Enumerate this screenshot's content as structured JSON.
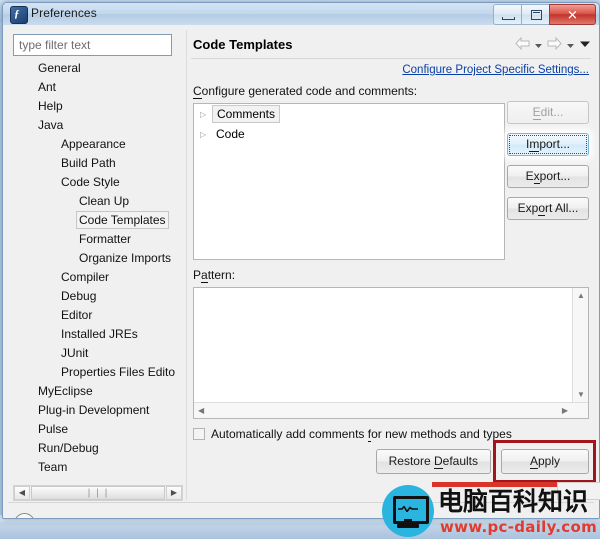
{
  "window": {
    "title": "Preferences",
    "icon": "eclipse-icon",
    "icon_glyph": "ƒ",
    "controls": {
      "minimize": "minimize-button",
      "maximize": "maximize-button",
      "close_label": "✕"
    }
  },
  "sidebar": {
    "filter": {
      "placeholder": "type filter text",
      "value": ""
    },
    "items": [
      {
        "label": "General",
        "level": 0,
        "selected": false
      },
      {
        "label": "Ant",
        "level": 0,
        "selected": false
      },
      {
        "label": "Help",
        "level": 0,
        "selected": false
      },
      {
        "label": "Java",
        "level": 0,
        "selected": false
      },
      {
        "label": "Appearance",
        "level": 1,
        "selected": false
      },
      {
        "label": "Build Path",
        "level": 1,
        "selected": false
      },
      {
        "label": "Code Style",
        "level": 1,
        "selected": false
      },
      {
        "label": "Clean Up",
        "level": 2,
        "selected": false
      },
      {
        "label": "Code Templates",
        "level": 2,
        "selected": true
      },
      {
        "label": "Formatter",
        "level": 2,
        "selected": false
      },
      {
        "label": "Organize Imports",
        "level": 2,
        "selected": false
      },
      {
        "label": "Compiler",
        "level": 1,
        "selected": false
      },
      {
        "label": "Debug",
        "level": 1,
        "selected": false
      },
      {
        "label": "Editor",
        "level": 1,
        "selected": false
      },
      {
        "label": "Installed JREs",
        "level": 1,
        "selected": false
      },
      {
        "label": "JUnit",
        "level": 1,
        "selected": false
      },
      {
        "label": "Properties Files Edito",
        "level": 1,
        "selected": false
      },
      {
        "label": "MyEclipse",
        "level": 0,
        "selected": false
      },
      {
        "label": "Plug-in Development",
        "level": 0,
        "selected": false
      },
      {
        "label": "Pulse",
        "level": 0,
        "selected": false
      },
      {
        "label": "Run/Debug",
        "level": 0,
        "selected": false
      },
      {
        "label": "Team",
        "level": 0,
        "selected": false
      }
    ],
    "scrollbar": {
      "left_arrow": "◀",
      "right_arrow": "▶",
      "grip": "❘❘❘"
    }
  },
  "panel": {
    "title": "Code Templates",
    "nav": {
      "back": "back-arrow",
      "back_menu": "back-dropdown",
      "forward": "forward-arrow",
      "forward_menu": "forward-dropdown",
      "view_menu": "view-menu"
    },
    "project_settings_link": "Configure Project Specific Settings...",
    "configure_label_pre": "C",
    "configure_label_post": "onfigure generated code and comments:",
    "tree": [
      {
        "label": "Comments",
        "expander": "▷",
        "selected": true
      },
      {
        "label": "Code",
        "expander": "▷",
        "selected": false
      }
    ],
    "buttons": [
      {
        "label_pre": "",
        "label_mn": "E",
        "label_post": "dit...",
        "name": "edit-button",
        "state": "disabled"
      },
      {
        "label_pre": "I",
        "label_mn": "m",
        "label_post": "port...",
        "name": "import-button",
        "state": "hover"
      },
      {
        "label_pre": "E",
        "label_mn": "x",
        "label_post": "port...",
        "name": "export-button",
        "state": "normal"
      },
      {
        "label_pre": "Exp",
        "label_mn": "o",
        "label_post": "rt All...",
        "name": "export-all-button",
        "state": "normal"
      }
    ],
    "pattern": {
      "label_pre": "P",
      "label_mn": "a",
      "label_post": "ttern:",
      "value": "",
      "scroll_up": "▲",
      "scroll_down": "▼",
      "scroll_left": "◀",
      "scroll_right": "▶"
    },
    "checkbox": {
      "checked": false,
      "label_pre": "Automatically add comments ",
      "label_mn": "f",
      "label_post": "or new methods and types"
    },
    "footer_buttons": [
      {
        "label_pre": "Restore ",
        "label_mn": "D",
        "label_post": "efaults",
        "name": "restore-defaults-button",
        "highlighted": false
      },
      {
        "label_pre": "",
        "label_mn": "A",
        "label_post": "pply",
        "name": "apply-button",
        "highlighted": true
      }
    ],
    "help_label": "?"
  },
  "annotation": {
    "target": "apply-button",
    "color": "#a4141c"
  },
  "watermark": {
    "cn_text": "电脑百科知识",
    "url_text": "www.pc-daily.com",
    "accent": "#2ab4e0",
    "url_color": "#e23b2e"
  }
}
